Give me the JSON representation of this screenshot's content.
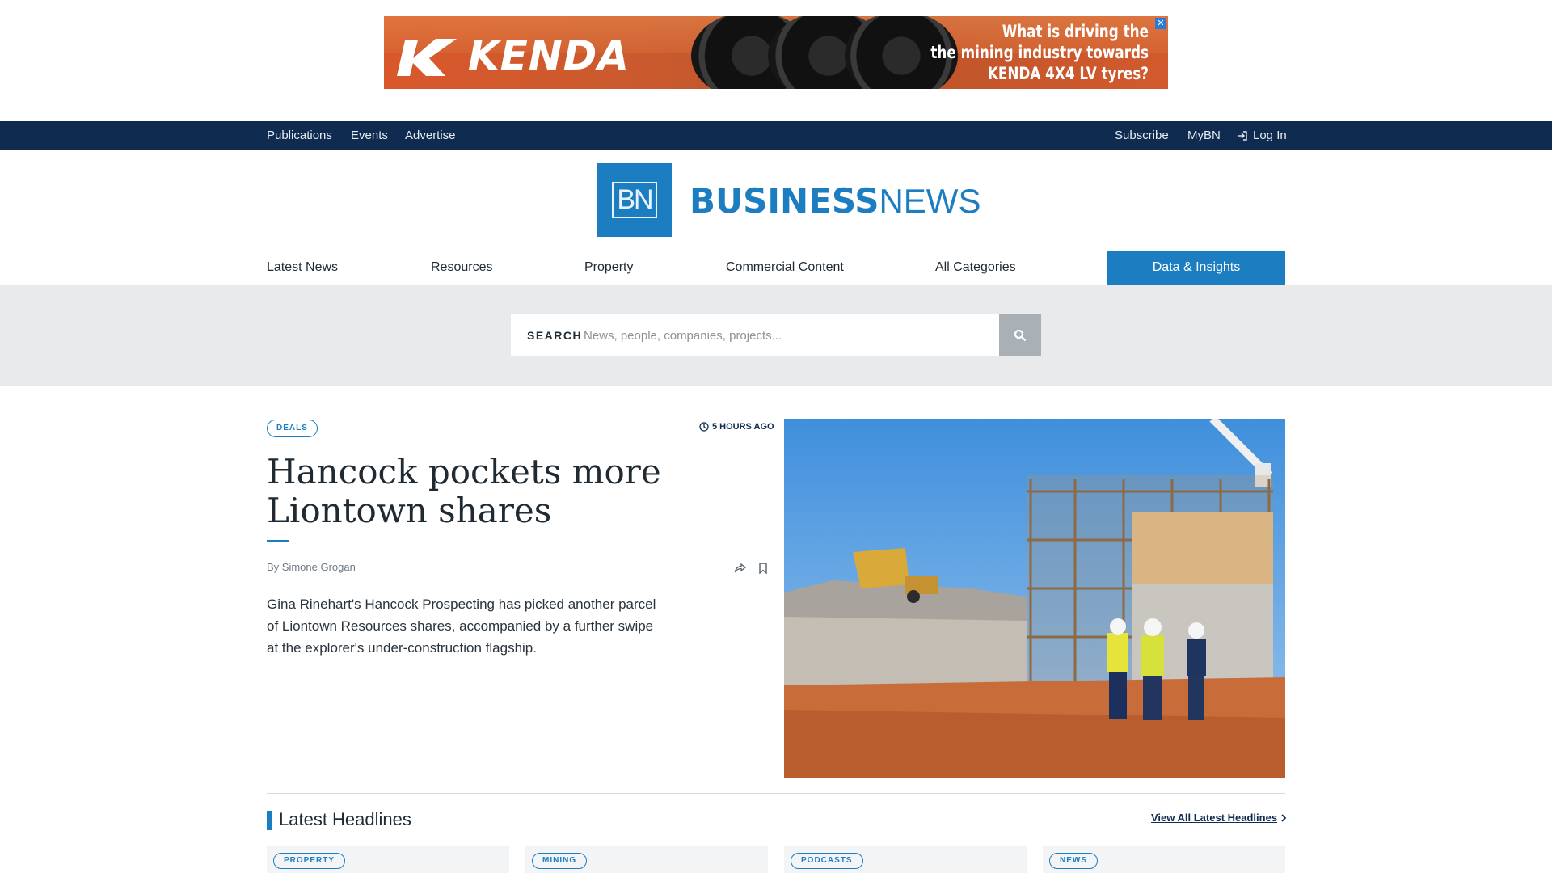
{
  "ad": {
    "brand": "KENDA",
    "copy_line1": "What is driving the",
    "copy_line2": "the mining industry towards",
    "copy_line3": "KENDA 4X4 LV tyres?",
    "close_glyph": "✕"
  },
  "topnav": {
    "left": [
      "Publications",
      "Events",
      "Advertise"
    ],
    "subscribe": "Subscribe",
    "mybn": "MyBN",
    "login": "Log In"
  },
  "logo": {
    "mark": "BN",
    "word_bold": "BUSINESS",
    "word_light": "NEWS"
  },
  "catnav": {
    "items": [
      "Latest News",
      "Resources",
      "Property",
      "Commercial Content",
      "All Categories"
    ],
    "highlight": "Data & Insights"
  },
  "search": {
    "label": "SEARCH",
    "placeholder": "News, people, companies, projects..."
  },
  "featured": {
    "tag": "DEALS",
    "time": "5 HOURS AGO",
    "headline": "Hancock pockets more Liontown shares",
    "byline": "By Simone Grogan",
    "summary": "Gina Rinehart's Hancock Prospecting has picked another parcel of Liontown Resources shares, accompanied by a further swipe at the explorer's under-construction flagship."
  },
  "latest": {
    "title": "Latest Headlines",
    "view_all": "View All Latest Headlines",
    "cards": [
      "PROPERTY",
      "MINING",
      "PODCASTS",
      "NEWS"
    ]
  },
  "colors": {
    "brand_blue": "#1c7dc0",
    "navy": "#0f2b4f",
    "search_band": "#e8eaec"
  },
  "icons": {
    "login": "login-icon",
    "search": "search-icon",
    "clock": "clock-icon",
    "share": "share-icon",
    "bookmark": "bookmark-icon",
    "chevron": "chevron-right-icon"
  }
}
